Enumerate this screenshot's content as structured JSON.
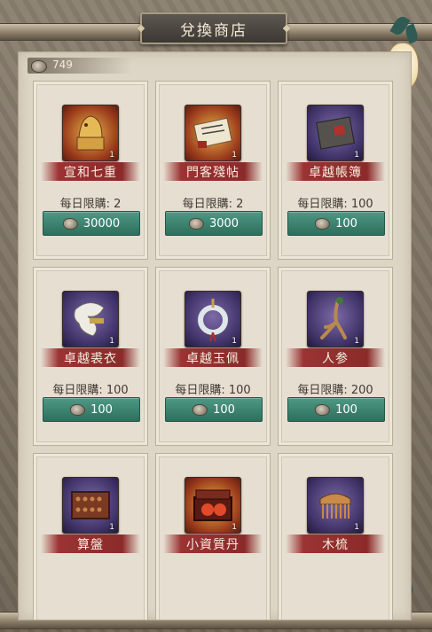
{
  "header": {
    "title": "兌換商店"
  },
  "currency": {
    "icon": "coin-icon",
    "amount": "749"
  },
  "items": [
    {
      "name": "宣和七重",
      "limit": "每日限購: 2",
      "price": "30000",
      "count": "1",
      "icon": "golden-seal-icon",
      "frame": "gold"
    },
    {
      "name": "門客殘帖",
      "limit": "每日限購: 2",
      "price": "3000",
      "count": "1",
      "icon": "scroll-letter-icon",
      "frame": "gold"
    },
    {
      "name": "卓越帳簿",
      "limit": "每日限購: 100",
      "price": "100",
      "count": "1",
      "icon": "ledger-book-icon",
      "frame": "purple"
    },
    {
      "name": "卓越裘衣",
      "limit": "每日限購: 100",
      "price": "100",
      "count": "1",
      "icon": "fur-coat-icon",
      "frame": "purple"
    },
    {
      "name": "卓越玉佩",
      "limit": "每日限購: 100",
      "price": "100",
      "count": "1",
      "icon": "jade-pendant-icon",
      "frame": "purple"
    },
    {
      "name": "人参",
      "limit": "每日限購: 200",
      "price": "100",
      "count": "1",
      "icon": "ginseng-icon",
      "frame": "purple"
    },
    {
      "name": "算盤",
      "count": "1",
      "icon": "abacus-icon",
      "frame": "purple"
    },
    {
      "name": "小資質丹",
      "count": "1",
      "icon": "red-pills-box-icon",
      "frame": "gold"
    },
    {
      "name": "木梳",
      "count": "1",
      "icon": "wooden-comb-icon",
      "frame": "purple"
    }
  ],
  "colors": {
    "banner": "#9b3333",
    "button": "#3d8571",
    "panel": "#ddd5c5"
  }
}
